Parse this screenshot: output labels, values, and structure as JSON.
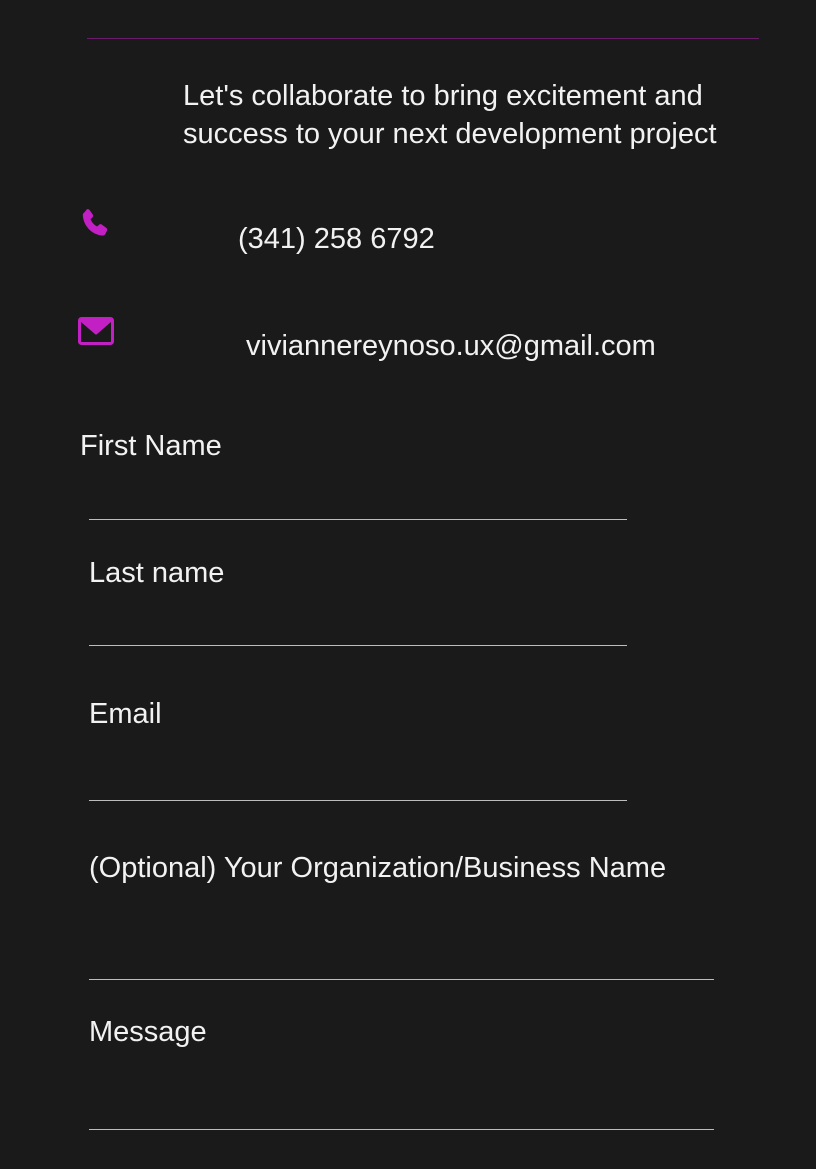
{
  "tagline": "Let's collaborate to bring excitement and success to your next development project",
  "contact": {
    "phone_icon": "phone-icon",
    "phone": "(341) 258 6792",
    "email_icon": "mail-icon",
    "email": "viviannereynoso.ux@gmail.com",
    "accent_color": "#c21fc4"
  },
  "form": {
    "first_name_label": "First Name",
    "first_name_value": "",
    "last_name_label": "Last name",
    "last_name_value": "",
    "email_label": "Email",
    "email_value": "",
    "organization_label": "(Optional) Your Organization/Business Name",
    "organization_value": "",
    "message_label": "Message",
    "message_value": ""
  }
}
